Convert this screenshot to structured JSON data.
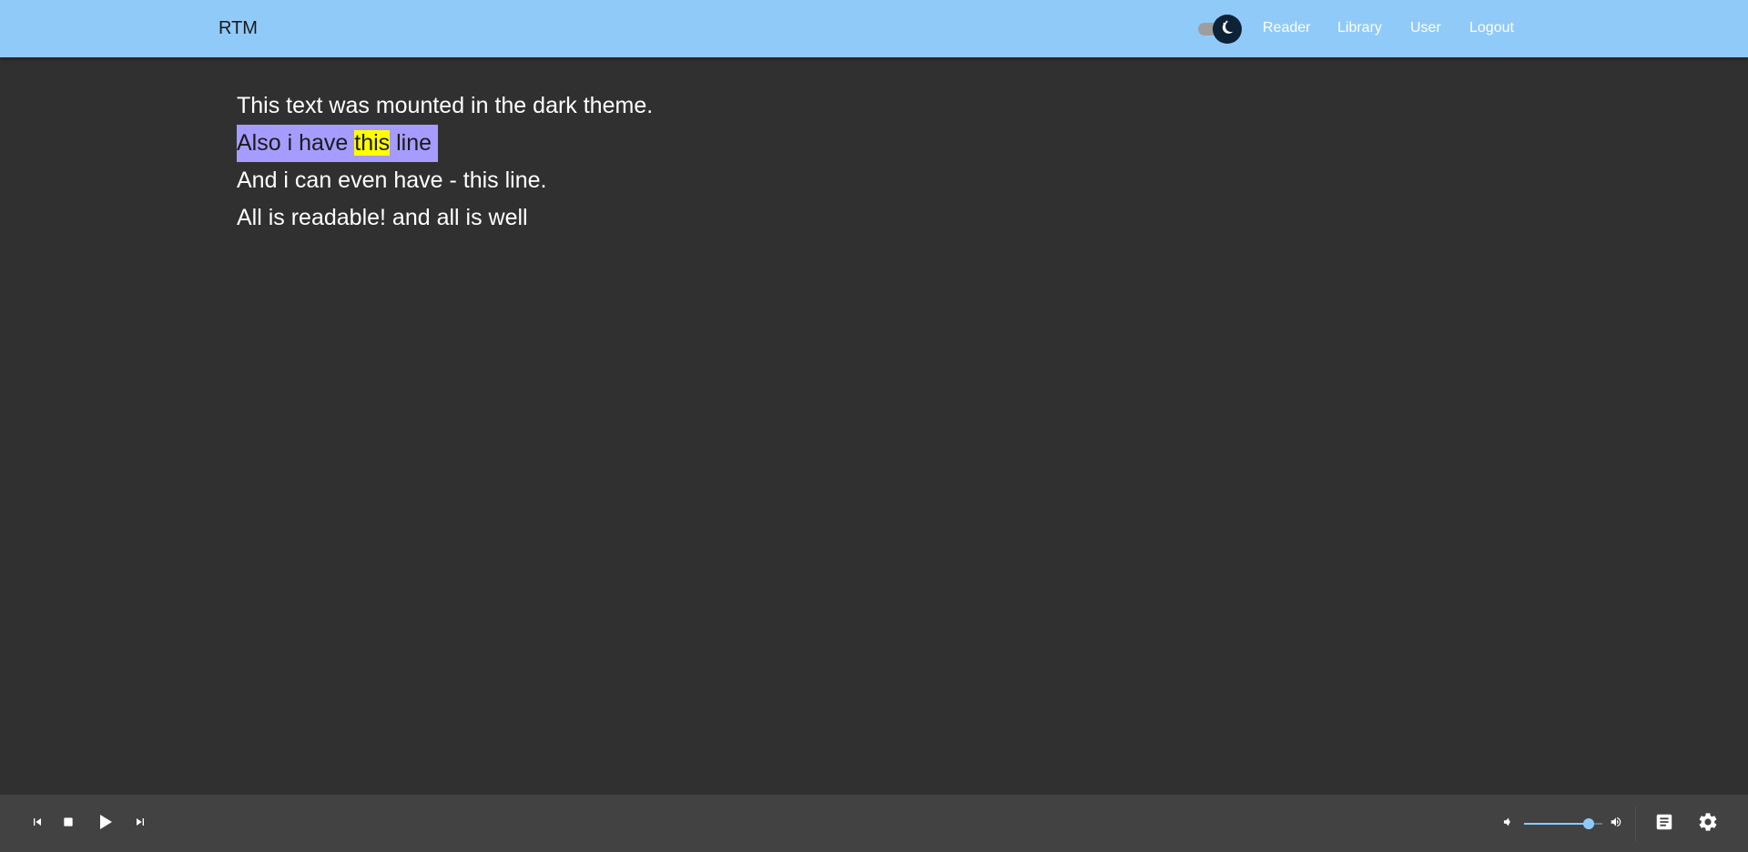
{
  "header": {
    "brand": "RTM",
    "nav": [
      "Reader",
      "Library",
      "User",
      "Logout"
    ],
    "theme_toggle_icon": "moon-icon",
    "bg_color": "#90caf9"
  },
  "reader": {
    "lines": [
      "This text was mounted in the dark theme.",
      "Also i have this line",
      "And i can even have - this line.",
      "All is readable! and all is well"
    ],
    "active_line": {
      "before": "Also i have ",
      "word": "this",
      "after": " line"
    },
    "line_highlight_color": "#a69cff",
    "word_highlight_color": "#ffff00"
  },
  "player": {
    "controls": [
      "skip-previous-icon",
      "stop-icon",
      "play-icon",
      "skip-next-icon"
    ],
    "volume_fraction": 0.82,
    "right_icons": [
      "volume-down-icon",
      "volume-up-icon",
      "notes-icon",
      "settings-icon"
    ]
  }
}
